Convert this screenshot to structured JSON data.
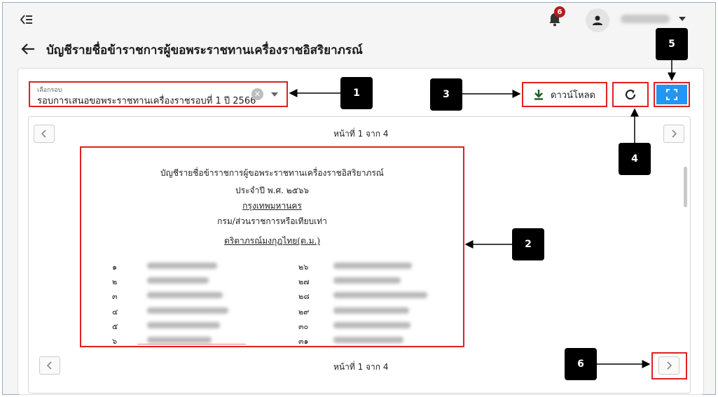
{
  "header": {
    "notification_count": "6"
  },
  "page": {
    "title": "บัญชีรายชื่อข้าราชการผู้ขอพระราชทานเครื่องราชอิสริยาภรณ์"
  },
  "filter": {
    "label": "เลือกรอบ",
    "value": "รอบการเสนอขอพระราชทานเครื่องราชรอบที่ 1  ปี 2566"
  },
  "toolbar": {
    "download_label": "ดาวน์โหลด"
  },
  "viewer": {
    "top_page_indicator": "หน้าที่ 1 จาก 4",
    "bottom_page_indicator": "หน้าที่ 1 จาก 4"
  },
  "document": {
    "line1": "บัญชีรายชื่อข้าราชการผู้ขอพระราชทานเครื่องราชอิสริยาภรณ์",
    "line2": "ประจำปี พ.ศ. ๒๕๖๖",
    "line3": "กรุงเทพมหานคร",
    "line4": "กรม/ส่วนราชการหรือเทียบเท่า",
    "line5": "ตริตาภรณ์มงกุฎไทย(ต.ม.)",
    "left_numbers": [
      "๑",
      "๒",
      "๓",
      "๔",
      "๕",
      "๖"
    ],
    "right_numbers": [
      "๒๖",
      "๒๗",
      "๒๘",
      "๒๙",
      "๓๐",
      "๓๑"
    ]
  },
  "callouts": {
    "c1": "1",
    "c2": "2",
    "c3": "3",
    "c4": "4",
    "c5": "5",
    "c6": "6"
  },
  "colors": {
    "highlight_border": "#e02020",
    "fullscreen_button": "#2196f3",
    "badge": "#b71c1c",
    "download_icon": "#1b5e20"
  }
}
